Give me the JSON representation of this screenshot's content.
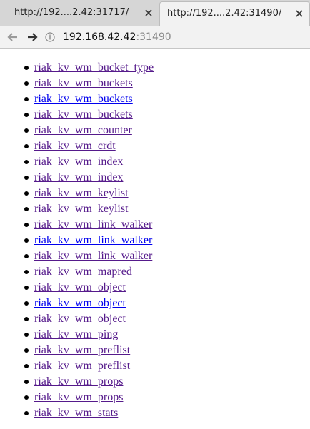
{
  "tabs": [
    {
      "title": "http://192....2.42:31717/",
      "active": false,
      "close_icon": "close-icon"
    },
    {
      "title": "http://192....2.42:31490/",
      "active": true,
      "close_icon": "close-icon"
    }
  ],
  "toolbar": {
    "back_icon": "back-arrow-icon",
    "forward_icon": "forward-arrow-icon",
    "info_icon": "info-icon",
    "url_host": "192.168.42.42",
    "url_port": ":31490"
  },
  "links": [
    {
      "label": "riak_kv_wm_bucket_type",
      "visited": true
    },
    {
      "label": "riak_kv_wm_buckets",
      "visited": true
    },
    {
      "label": "riak_kv_wm_buckets",
      "visited": false
    },
    {
      "label": "riak_kv_wm_buckets",
      "visited": true
    },
    {
      "label": "riak_kv_wm_counter",
      "visited": true
    },
    {
      "label": "riak_kv_wm_crdt",
      "visited": true
    },
    {
      "label": "riak_kv_wm_index",
      "visited": true
    },
    {
      "label": "riak_kv_wm_index",
      "visited": true
    },
    {
      "label": "riak_kv_wm_keylist",
      "visited": true
    },
    {
      "label": "riak_kv_wm_keylist",
      "visited": true
    },
    {
      "label": "riak_kv_wm_link_walker",
      "visited": true
    },
    {
      "label": "riak_kv_wm_link_walker",
      "visited": false
    },
    {
      "label": "riak_kv_wm_link_walker",
      "visited": true
    },
    {
      "label": "riak_kv_wm_mapred",
      "visited": true
    },
    {
      "label": "riak_kv_wm_object",
      "visited": true
    },
    {
      "label": "riak_kv_wm_object",
      "visited": false
    },
    {
      "label": "riak_kv_wm_object",
      "visited": true
    },
    {
      "label": "riak_kv_wm_ping",
      "visited": true
    },
    {
      "label": "riak_kv_wm_preflist",
      "visited": true
    },
    {
      "label": "riak_kv_wm_preflist",
      "visited": true
    },
    {
      "label": "riak_kv_wm_props",
      "visited": true
    },
    {
      "label": "riak_kv_wm_props",
      "visited": true
    },
    {
      "label": "riak_kv_wm_stats",
      "visited": true
    }
  ],
  "colors": {
    "visited_link": "#551a8b",
    "unvisited_link": "#0000ee"
  }
}
